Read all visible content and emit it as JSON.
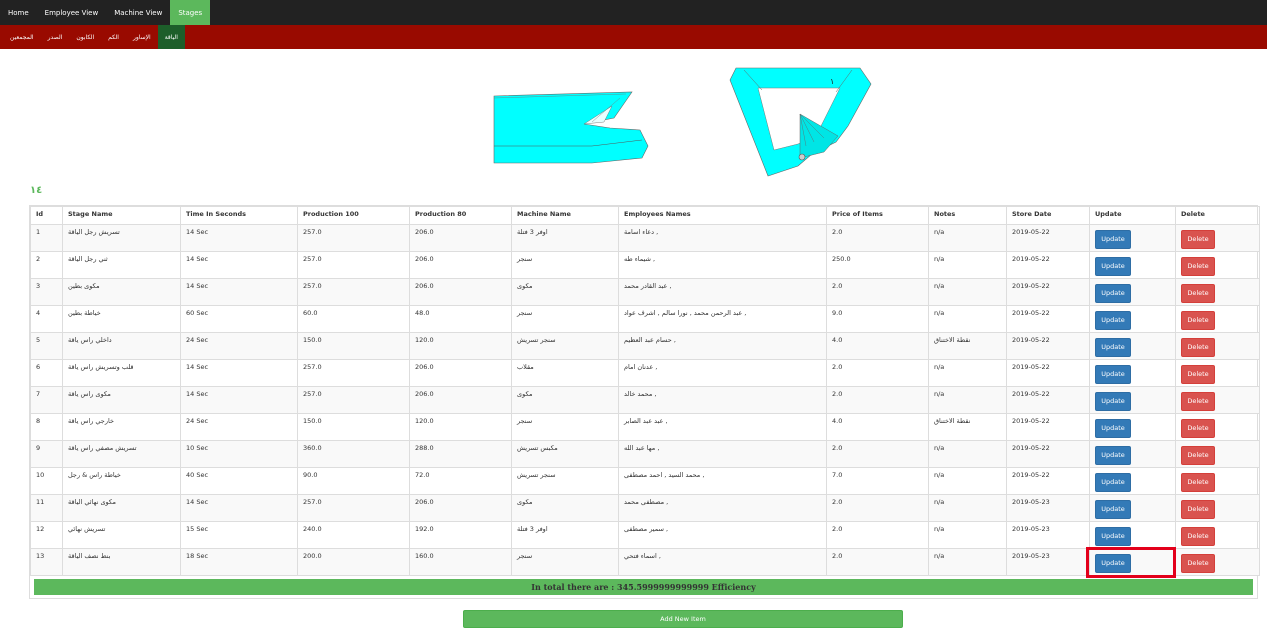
{
  "topnav": {
    "items": [
      {
        "label": "Home",
        "active": false
      },
      {
        "label": "Employee View",
        "active": false
      },
      {
        "label": "Machine View",
        "active": false
      },
      {
        "label": "Stages",
        "active": true
      }
    ]
  },
  "subnav": {
    "items": [
      {
        "label": "المجمعين",
        "active": false
      },
      {
        "label": "الصدر",
        "active": false
      },
      {
        "label": "الكابون",
        "active": false
      },
      {
        "label": "الكم",
        "active": false
      },
      {
        "label": "الإساور",
        "active": false
      },
      {
        "label": "الياقة",
        "active": true
      }
    ]
  },
  "images": {
    "left": "collar-band-icon",
    "right": "collar-icon",
    "right_label": "١"
  },
  "count_label": "١٤",
  "table": {
    "headers": [
      "Id",
      "Stage Name",
      "Time In Seconds",
      "Production 100",
      "Production 80",
      "Machine Name",
      "Employees Names",
      "Price of Items",
      "Notes",
      "Store Date",
      "Update",
      "Delete"
    ],
    "update_label": "Update",
    "delete_label": "Delete",
    "rows": [
      {
        "id": "1",
        "stage": "تسريش رجل الياقة",
        "time": "14 Sec",
        "p100": "257.0",
        "p80": "206.0",
        "machine": "اوفر 3 فتلة",
        "employees": "دعاء اسامة ,",
        "price": "2.0",
        "notes": "n/a",
        "date": "2019-05-22"
      },
      {
        "id": "2",
        "stage": "ثني رجل الياقة",
        "time": "14 Sec",
        "p100": "257.0",
        "p80": "206.0",
        "machine": "سنجر",
        "employees": "شيماء طه ,",
        "price": "250.0",
        "notes": "n/a",
        "date": "2019-05-22"
      },
      {
        "id": "3",
        "stage": "مكوى بطين",
        "time": "14 Sec",
        "p100": "257.0",
        "p80": "206.0",
        "machine": "مكوى",
        "employees": "عبد القادر محمد ,",
        "price": "2.0",
        "notes": "n/a",
        "date": "2019-05-22"
      },
      {
        "id": "4",
        "stage": "خياطة بطين",
        "time": "60 Sec",
        "p100": "60.0",
        "p80": "48.0",
        "machine": "سنجر",
        "employees": "عبد الرحمن محمد , نورا سالم , اشرف عواد ,",
        "price": "9.0",
        "notes": "n/a",
        "date": "2019-05-22"
      },
      {
        "id": "5",
        "stage": "داخلي راس ياقة",
        "time": "24 Sec",
        "p100": "150.0",
        "p80": "120.0",
        "machine": "سنجر تسريش",
        "employees": "حسام عبد العظيم ,",
        "price": "4.0",
        "notes": "نقطة الاختناق",
        "date": "2019-05-22"
      },
      {
        "id": "6",
        "stage": "قلب وتسريش راس ياقة",
        "time": "14 Sec",
        "p100": "257.0",
        "p80": "206.0",
        "machine": "مقلاب",
        "employees": "عدنان امام ,",
        "price": "2.0",
        "notes": "n/a",
        "date": "2019-05-22"
      },
      {
        "id": "7",
        "stage": "مكوى راس ياقة",
        "time": "14 Sec",
        "p100": "257.0",
        "p80": "206.0",
        "machine": "مكوى",
        "employees": "محمد خالد ,",
        "price": "2.0",
        "notes": "n/a",
        "date": "2019-05-22"
      },
      {
        "id": "8",
        "stage": "خارجي راس ياقة",
        "time": "24 Sec",
        "p100": "150.0",
        "p80": "120.0",
        "machine": "سنجر",
        "employees": "عبد عبد الصابر ,",
        "price": "4.0",
        "notes": "نقطة الاختناق",
        "date": "2019-05-22"
      },
      {
        "id": "9",
        "stage": "تسريش مصفي راس ياقة",
        "time": "10 Sec",
        "p100": "360.0",
        "p80": "288.0",
        "machine": "مكبس تسريش",
        "employees": "مها عبد الله ,",
        "price": "2.0",
        "notes": "n/a",
        "date": "2019-05-22"
      },
      {
        "id": "10",
        "stage": "خياطة راس & رجل",
        "time": "40 Sec",
        "p100": "90.0",
        "p80": "72.0",
        "machine": "سنجر تسريش",
        "employees": "محمد السيد , احمد مصطفى ,",
        "price": "7.0",
        "notes": "n/a",
        "date": "2019-05-22"
      },
      {
        "id": "11",
        "stage": "مكوى نهائي الياقة",
        "time": "14 Sec",
        "p100": "257.0",
        "p80": "206.0",
        "machine": "مكوى",
        "employees": "مصطفى محمد ,",
        "price": "2.0",
        "notes": "n/a",
        "date": "2019-05-23"
      },
      {
        "id": "12",
        "stage": "تسريش نهائي",
        "time": "15 Sec",
        "p100": "240.0",
        "p80": "192.0",
        "machine": "اوفر 3 فتلة",
        "employees": "سمير مصطفى ,",
        "price": "2.0",
        "notes": "n/a",
        "date": "2019-05-23"
      },
      {
        "id": "13",
        "stage": "بنط نصف الياقة",
        "time": "18 Sec",
        "p100": "200.0",
        "p80": "160.0",
        "machine": "سنجر",
        "employees": "اسماء فتحي ,",
        "price": "2.0",
        "notes": "n/a",
        "date": "2019-05-23"
      }
    ]
  },
  "total_text": "In total there are : 345.5999999999999 Efficiency",
  "add_button_label": "Add New Item",
  "colors": {
    "navbar": "#222222",
    "active_green": "#5cb85c",
    "subnav_red": "#990a00",
    "subnav_active": "#1d5e2a",
    "update_blue": "#337ab7",
    "delete_red": "#d9534f",
    "highlight": "#e3001b",
    "cyan": "#00ffff"
  }
}
